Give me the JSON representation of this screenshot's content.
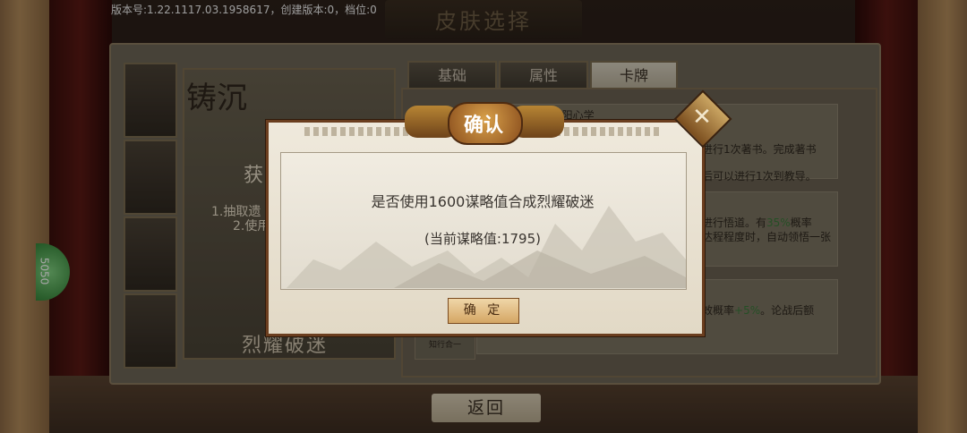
{
  "version_text": "版本号:1.22.1117.03.1958617，创建版本:0，档位:0",
  "page_title": "皮肤选择",
  "tabs": [
    {
      "label": "基础"
    },
    {
      "label": "属性"
    },
    {
      "label": "卡牌"
    }
  ],
  "card": {
    "calligraphy": "铸沉",
    "get_text": "获",
    "line1": "1.抽取遗",
    "line2": "2.使用",
    "name": "烈耀破迷"
  },
  "info_rows": [
    {
      "title": "9阳心学",
      "text1": "进行1次著书。完成著书",
      "text2": "后可以进行1次到教导。"
    },
    {
      "text1": "进行悟道。有",
      "highlight": "35%",
      "text1b": "概率",
      "text2": "达程程度时，自动领悟一张"
    },
    {
      "text1": "效概率",
      "highlight": "+5%",
      "text1b": "。论战后额"
    }
  ],
  "card_thumb_label": "知行合一",
  "side_pill_text": "5050",
  "back_button_label": "返回",
  "dialog": {
    "title": "确认",
    "message": "是否使用1600谋略值合成烈耀破迷",
    "current_value": "(当前谋略值:1795)",
    "confirm_label": "确 定",
    "close_icon": "close-icon"
  }
}
